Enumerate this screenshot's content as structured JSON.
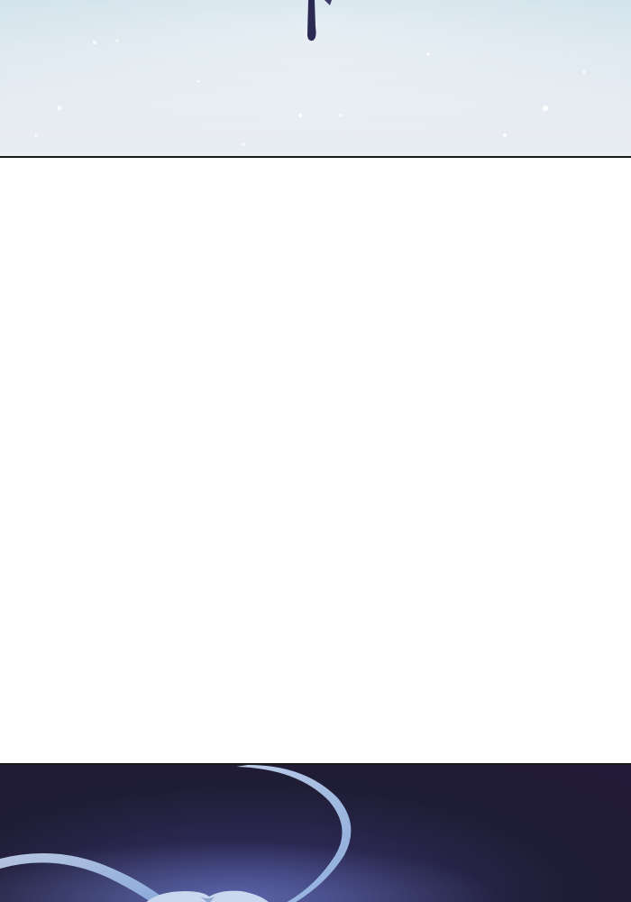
{
  "comic": {
    "panels": [
      {
        "scene": "snow-field",
        "background": "#e6ecf2"
      },
      {
        "scene": "night-void",
        "background": "#1f1d35"
      }
    ],
    "colors": {
      "snow": "#e6ecf2",
      "sky_tint": "#cfe0ea",
      "ink": "#2a2a52",
      "night": "#1f1d35",
      "ribbon": "#a9c4e8"
    }
  }
}
